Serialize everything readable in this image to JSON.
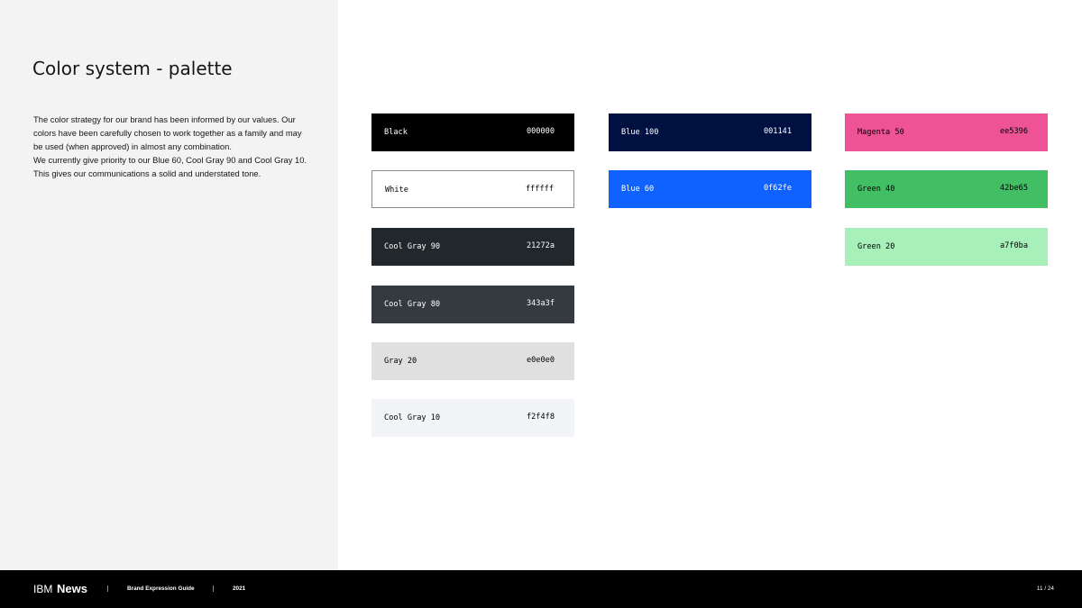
{
  "page": {
    "title": "Color system - palette",
    "intro_paragraphs": [
      "The color strategy for our brand has been informed by our values. Our colors have been carefully chosen to work together as a family and may be used (when approved) in almost any combination.",
      "We currently give priority to our Blue 60, Cool Gray 90 and Cool Gray 10. This gives our communications a solid and understated tone."
    ]
  },
  "palette": {
    "neutrals": [
      {
        "name": "Black",
        "hex": "000000",
        "bg": "#000000",
        "text": "#ffffff"
      },
      {
        "name": "White",
        "hex": "ffffff",
        "bg": "#ffffff",
        "text": "#000000"
      },
      {
        "name": "Cool Gray 90",
        "hex": "21272a",
        "bg": "#21272a",
        "text": "#ffffff"
      },
      {
        "name": "Cool Gray 80",
        "hex": "343a3f",
        "bg": "#343a3f",
        "text": "#ffffff"
      },
      {
        "name": "Gray 20",
        "hex": "e0e0e0",
        "bg": "#e0e0e0",
        "text": "#000000"
      },
      {
        "name": "Cool Gray 10",
        "hex": "f2f4f8",
        "bg": "#f2f4f8",
        "text": "#000000"
      }
    ],
    "blues": [
      {
        "name": "Blue 100",
        "hex": "001141",
        "bg": "#001141",
        "text": "#ffffff"
      },
      {
        "name": "Blue 60",
        "hex": "0f62fe",
        "bg": "#0f62fe",
        "text": "#ffffff"
      }
    ],
    "accents": [
      {
        "name": "Magenta 50",
        "hex": "ee5396",
        "bg": "#ee5396",
        "text": "#000000"
      },
      {
        "name": "Green 40",
        "hex": "42be65",
        "bg": "#42be65",
        "text": "#000000"
      },
      {
        "name": "Green 20",
        "hex": "a7f0ba",
        "bg": "#a7f0ba",
        "text": "#000000"
      }
    ]
  },
  "footer": {
    "brand_prefix": "IBM",
    "brand_name": "News",
    "guide": "Brand Expression Guide",
    "year": "2021",
    "page_number": "11 / 24"
  }
}
